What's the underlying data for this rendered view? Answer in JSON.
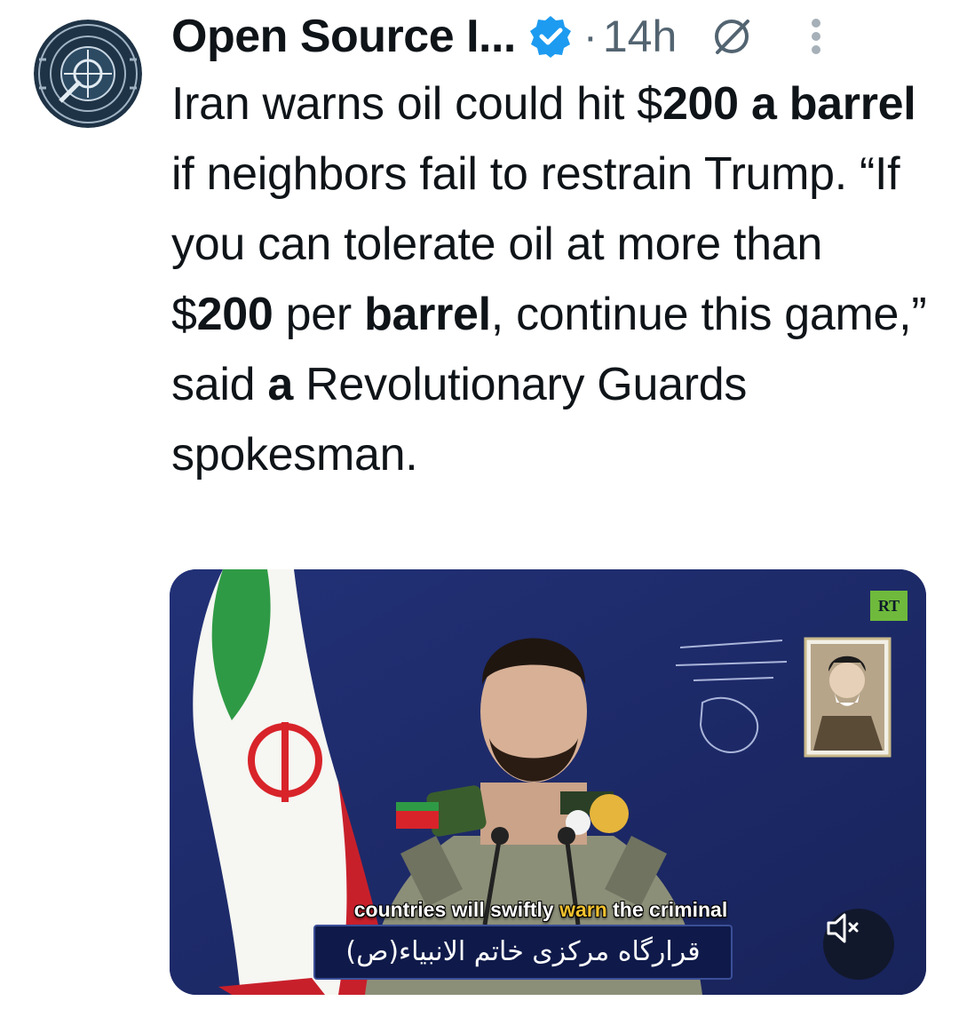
{
  "tweet": {
    "author": "Open Source I...",
    "dot": "·",
    "time": "14h",
    "text_parts": [
      {
        "t": "Iran warns oil could hit $",
        "b": false
      },
      {
        "t": "200 a barrel",
        "b": true
      },
      {
        "t": " if neighbors fail to restrain Trump. “If you can tolerate oil at more than $",
        "b": false
      },
      {
        "t": "200",
        "b": true
      },
      {
        "t": " per ",
        "b": false
      },
      {
        "t": "barrel",
        "b": true
      },
      {
        "t": ", continue this game,” said ",
        "b": false
      },
      {
        "t": "a",
        "b": true
      },
      {
        "t": " Revolutionary Guards spokesman.",
        "b": false
      }
    ]
  },
  "media": {
    "subtitle_before": "countries will swiftly",
    "subtitle_highlight": "warn",
    "subtitle_after": "the criminal",
    "lower_third": "قرارگاه مرکزی خاتم الانبیاء(ص)",
    "channel_logo": "RT"
  },
  "colors": {
    "verified": "#1d9bf0",
    "muted_text": "#536471",
    "studio_bg": "#1c2a68",
    "subtitle_highlight": "#f2c12e"
  },
  "icons": [
    "verified-badge-icon",
    "grok-icon",
    "more-icon",
    "mute-icon"
  ]
}
